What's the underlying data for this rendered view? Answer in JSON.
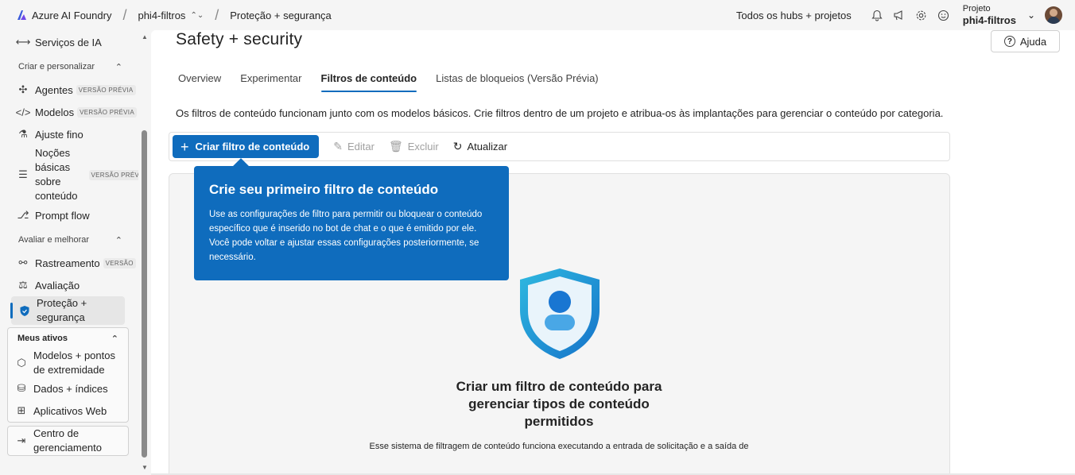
{
  "topbar": {
    "brand": "Azure AI Foundry",
    "crumb_project": "phi4-filtros",
    "crumb_page": "Proteção + segurança",
    "hubs_link": "Todos os hubs + projetos",
    "project_label": "Projeto",
    "project_name": "phi4-filtros"
  },
  "sidebar": {
    "services": "Serviços de IA",
    "section_create": "Criar e personalizar",
    "agents": "Agentes",
    "agents_badge": "VERSÃO PRÉVIA",
    "models": "Modelos",
    "models_badge": "VERSÃO PRÉVIA",
    "finetune": "Ajuste fino",
    "content_basics_1": "Noções",
    "content_basics_2": "básicas",
    "content_basics_3": "sobre",
    "content_basics_4": "conteúdo",
    "content_badge": "VERSÃO PRÉVI",
    "promptflow": "Prompt flow",
    "section_eval": "Avaliar e melhorar",
    "tracing": "Rastreamento",
    "tracing_badge": "VERSÃO",
    "evaluation": "Avaliação",
    "safety_1": "Proteção +",
    "safety_2": "segurança",
    "section_assets": "Meus ativos",
    "models_endpoints_1": "Modelos + pontos",
    "models_endpoints_2": "de extremidade",
    "data_indexes": "Dados + índices",
    "web_apps": "Aplicativos Web",
    "mgmt_1": "Centro de",
    "mgmt_2": "gerenciamento"
  },
  "main": {
    "title": "Safety + security",
    "help": "Ajuda",
    "tabs": [
      "Overview",
      "Experimentar",
      "Filtros de conteúdo",
      "Listas de bloqueios (Versão Prévia)"
    ],
    "description": "Os filtros de conteúdo funcionam junto com os modelos básicos. Crie filtros dentro de um projeto e atribua-os às implantações para gerenciar o conteúdo por categoria.",
    "toolbar": {
      "create": "Criar filtro de conteúdo",
      "edit": "Editar",
      "delete": "Excluir",
      "refresh": "Atualizar"
    },
    "empty_title": "Criar um filtro de conteúdo para gerenciar tipos de conteúdo permitidos",
    "empty_desc": "Esse sistema de filtragem de conteúdo funciona executando a entrada de solicitação e a saída de"
  },
  "popover": {
    "title": "Crie seu primeiro filtro de conteúdo",
    "body": "Use as configurações de filtro para permitir ou bloquear o conteúdo específico que é inserido no bot de chat e o que é emitido por ele. Você pode voltar e ajustar essas configurações posteriormente, se necessário."
  },
  "colors": {
    "accent": "#0f6cbd",
    "shield": "#1d9fd8"
  }
}
